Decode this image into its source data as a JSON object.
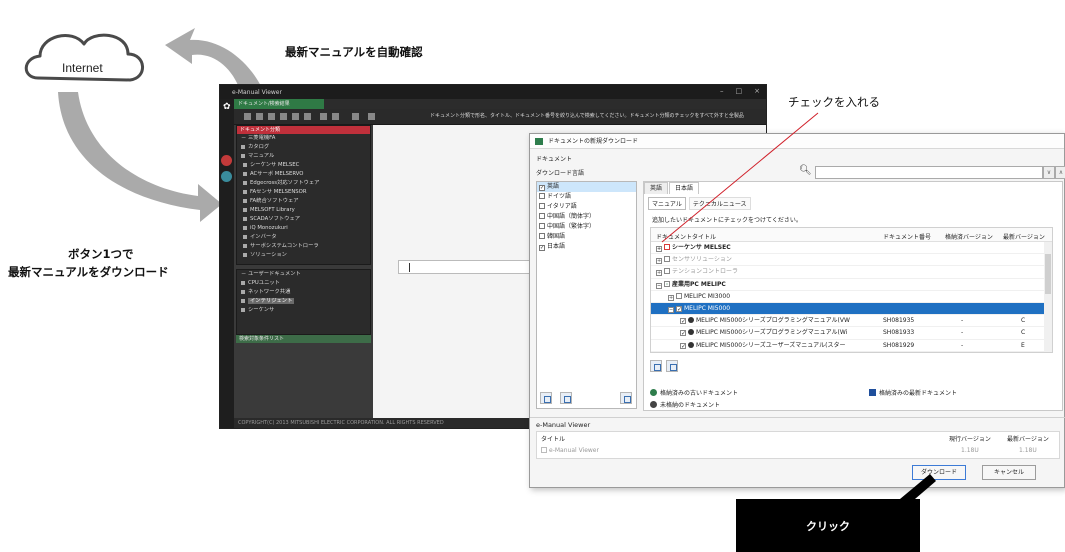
{
  "annotations": {
    "cloud_label": "Internet",
    "top_caption": "最新マニュアルを自動確認",
    "left_caption_line1": "ボタン1つで",
    "left_caption_line2": "最新マニュアルをダウンロード",
    "check_caption": "チェックを入れる",
    "click_label": "クリック"
  },
  "viewer": {
    "title": "e-Manual Viewer",
    "win_buttons": [
      "–",
      "□",
      "×"
    ],
    "tab": "ドキュメント/検索結果",
    "search_hint": "ドキュメント分類で形名、タイトル、ドキュメント番号を絞り込んで検索してください。ドキュメント分類のチェックをすべて外すと全製品",
    "nav_header": "ドキュメント分類",
    "nav_items": [
      "－ 三菱電機FA",
      "カタログ",
      "マニュアル",
      "シーケンサ MELSEC",
      "ACサーボ MELSERVO",
      "Edgecross対応ソフトウェア",
      "FAセンサ MELSENSOR",
      "FA統合ソフトウェア",
      "MELSOFT Library",
      "SCADAソフトウェア",
      "iQ Monozukuri",
      "インバータ",
      "サーボシステムコントローラ",
      "ソリューション"
    ],
    "user_header": "－ ユーザードキュメント",
    "user_items": [
      "CPUユニット",
      "ネットワーク共通",
      "インテリジェント",
      "シーケンサ"
    ],
    "bottom_label": "検索対象条件リスト",
    "copyright": "COPYRIGHT(C) 2013 MITSUBISHI ELECTRIC CORPORATION. ALL RIGHTS RESERVED"
  },
  "dialog": {
    "title": "ドキュメントの新規ダウンロード",
    "doc_label": "ドキュメント",
    "download_lang_label": "ダウンロード言語",
    "languages": [
      {
        "label": "英語",
        "checked": true,
        "selected": true
      },
      {
        "label": "ドイツ語",
        "checked": false
      },
      {
        "label": "イタリア語",
        "checked": false
      },
      {
        "label": "中国語（簡体字）",
        "checked": false
      },
      {
        "label": "中国語（繁体字）",
        "checked": false
      },
      {
        "label": "韓国語",
        "checked": false
      },
      {
        "label": "日本語",
        "checked": true
      }
    ],
    "tabs": [
      "英語",
      "日本語"
    ],
    "subtabs": [
      "マニュアル",
      "テクニカルニュース"
    ],
    "instruction": "追加したいドキュメントにチェックをつけてください。",
    "columns": {
      "title": "ドキュメントタイトル",
      "number": "ドキュメント番号",
      "installed": "格納済バージョン",
      "latest": "最新バージョン"
    },
    "rows": [
      {
        "indent": 0,
        "exp": "+",
        "title": "シーケンサ MELSEC",
        "bold": true,
        "style": "red"
      },
      {
        "indent": 0,
        "exp": "+",
        "title": "センサソリューション",
        "dim": true
      },
      {
        "indent": 0,
        "exp": "+",
        "title": "テンションコントローラ",
        "dim": true
      },
      {
        "indent": 0,
        "exp": "−",
        "title": "産業用PC MELIPC",
        "bold": true,
        "style": "part"
      },
      {
        "indent": 1,
        "exp": "+",
        "title": "MELIPC MI3000"
      },
      {
        "indent": 1,
        "exp": "−",
        "title": "MELIPC MI5000",
        "highlight": true,
        "style": "checked"
      },
      {
        "indent": 2,
        "title": "MELIPC MI5000シリーズプログラミングマニュアル(VW",
        "number": "SH081935",
        "installed": "-",
        "latest": "C",
        "style": "checked",
        "status": true
      },
      {
        "indent": 2,
        "title": "MELIPC MI5000シリーズプログラミングマニュアル(Wi",
        "number": "SH081933",
        "installed": "-",
        "latest": "C",
        "style": "checked",
        "status": true
      },
      {
        "indent": 2,
        "title": "MELIPC MI5000シリーズユーザーズマニュアル(スター",
        "number": "SH081929",
        "installed": "-",
        "latest": "E",
        "style": "checked",
        "status": true
      }
    ],
    "legend": {
      "old": "格納済みの古いドキュメント",
      "latest": "格納済みの最新ドキュメント",
      "not_stored": "未格納のドキュメント"
    },
    "ev_section": "e-Manual Viewer",
    "ev_columns": {
      "title": "タイトル",
      "current": "現行バージョン",
      "latest": "最新バージョン"
    },
    "ev_row": {
      "title": "e-Manual Viewer",
      "current": "1.18U",
      "latest": "1.18U"
    },
    "download_button": "ダウンロード",
    "cancel_button": "キャンセル"
  },
  "colors": {
    "arrow": "#a9a9a9",
    "leader_line": "#d0202a",
    "viewer_bg": "#3a3a3a",
    "viewer_accent": "#2f7a45",
    "highlight_row": "#1f70c2"
  }
}
